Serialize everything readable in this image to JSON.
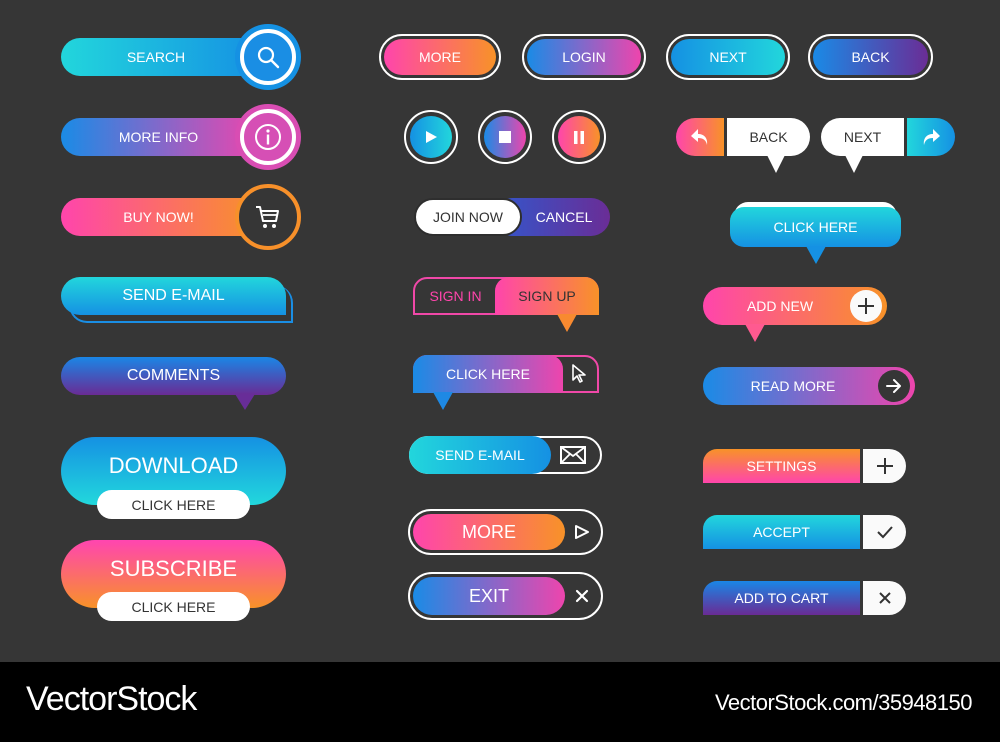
{
  "colors": {
    "background": "#363636",
    "cyan": "#22d6dc",
    "blue": "#1591e3",
    "pink": "#ff45ac",
    "orange": "#f89228",
    "purple": "#6a2d96",
    "footer": "#000000"
  },
  "left_column": {
    "search": {
      "label": "SEARCH",
      "icon": "search-icon"
    },
    "more_info": {
      "label": "MORE INFO",
      "icon": "info-icon"
    },
    "buy_now": {
      "label": "BUY NOW!",
      "icon": "cart-icon"
    },
    "send_email": {
      "label": "SEND E-MAIL"
    },
    "comments": {
      "label": "COMMENTS"
    },
    "download": {
      "label": "DOWNLOAD",
      "sub_label": "CLICK HERE"
    },
    "subscribe": {
      "label": "SUBSCRIBE",
      "sub_label": "CLICK HERE"
    }
  },
  "top_row": {
    "more": "MORE",
    "login": "LOGIN",
    "next": "NEXT",
    "back": "BACK"
  },
  "media_controls": [
    {
      "name": "play",
      "icon": "play-icon"
    },
    {
      "name": "stop",
      "icon": "stop-icon"
    },
    {
      "name": "pause",
      "icon": "pause-icon"
    }
  ],
  "middle_column": {
    "join_now": "JOIN NOW",
    "cancel": "CANCEL",
    "sign_in": "SIGN IN",
    "sign_up": "SIGN UP",
    "click_here": {
      "label": "CLICK HERE",
      "icon": "cursor-icon"
    },
    "send_email": {
      "label": "SEND E-MAIL",
      "icon": "envelope-icon"
    },
    "more": {
      "label": "MORE",
      "icon": "play-outline-icon"
    },
    "exit": {
      "label": "EXIT",
      "icon": "close-icon"
    }
  },
  "right_column": {
    "back": {
      "label": "BACK",
      "icon": "reply-arrow-icon"
    },
    "next": {
      "label": "NEXT",
      "icon": "forward-arrow-icon"
    },
    "click_here": "CLICK HERE",
    "add_new": {
      "label": "ADD NEW",
      "icon": "plus-icon"
    },
    "read_more": {
      "label": "READ MORE",
      "icon": "arrow-right-icon"
    },
    "settings": {
      "label": "SETTINGS",
      "icon": "plus-icon"
    },
    "accept": {
      "label": "ACCEPT",
      "icon": "check-icon"
    },
    "add_to_cart": {
      "label": "ADD TO CART",
      "icon": "close-icon"
    }
  },
  "footer": {
    "brand": "VectorStock",
    "url": "VectorStock.com/35948150"
  }
}
